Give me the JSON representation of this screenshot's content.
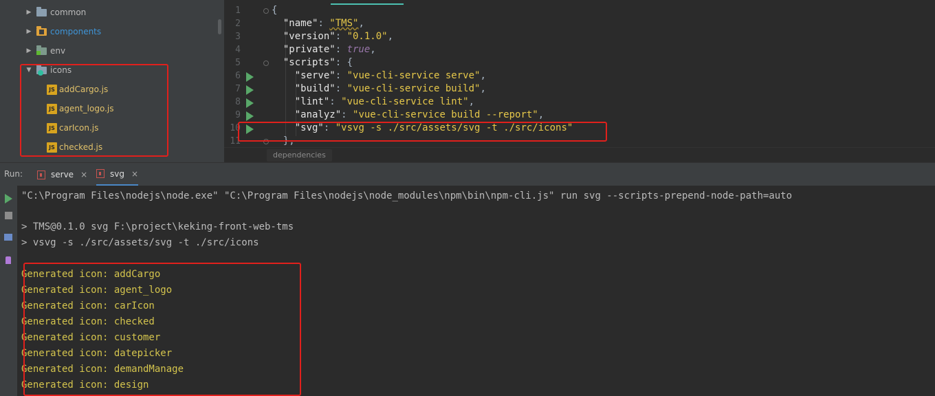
{
  "tree": {
    "items": [
      {
        "label": "common",
        "kind": "folder"
      },
      {
        "label": "components",
        "kind": "folder"
      },
      {
        "label": "env",
        "kind": "folder"
      },
      {
        "label": "icons",
        "kind": "folder"
      },
      {
        "label": "addCargo.js",
        "kind": "file"
      },
      {
        "label": "agent_logo.js",
        "kind": "file"
      },
      {
        "label": "carIcon.js",
        "kind": "file"
      },
      {
        "label": "checked.js",
        "kind": "file"
      }
    ],
    "js_badge": "JS"
  },
  "editor": {
    "line_numbers": [
      "1",
      "2",
      "3",
      "4",
      "5",
      "6",
      "7",
      "8",
      "9",
      "10",
      "11"
    ],
    "lines": {
      "l1": "{",
      "l2_key": "\"name\"",
      "l2_val": "\"TMS\"",
      "l3_key": "\"version\"",
      "l3_val": "\"0.1.0\"",
      "l4_key": "\"private\"",
      "l4_val": "true",
      "l5_key": "\"scripts\"",
      "l5_rest": ": {",
      "l6_key": "\"serve\"",
      "l6_val": "\"vue-cli-service serve\"",
      "l7_key": "\"build\"",
      "l7_val": "\"vue-cli-service build\"",
      "l8_key": "\"lint\"",
      "l8_val": "\"vue-cli-service lint\"",
      "l9_key": "\"analyz\"",
      "l9_val": "\"vue-cli-service build --report\"",
      "l10_key": "\"svg\"",
      "l10_val": "\"vsvg -s ./src/assets/svg -t ./src/icons\"",
      "l11": "},"
    },
    "breadcrumb": "dependencies"
  },
  "run": {
    "label": "Run:",
    "tabs": [
      {
        "label": "serve"
      },
      {
        "label": "svg"
      }
    ],
    "close_glyph": "×",
    "console": {
      "command": "\"C:\\Program Files\\nodejs\\node.exe\" \"C:\\Program Files\\nodejs\\node_modules\\npm\\bin\\npm-cli.js\" run svg --scripts-prepend-node-path=auto",
      "line2": "> TMS@0.1.0 svg F:\\project\\keking-front-web-tms",
      "line3": "> vsvg -s ./src/assets/svg -t ./src/icons",
      "generated": [
        "Generated icon: addCargo",
        "Generated icon: agent_logo",
        "Generated icon: carIcon",
        "Generated icon: checked",
        "Generated icon: customer",
        "Generated icon: datepicker",
        "Generated icon: demandManage",
        "Generated icon: design"
      ]
    }
  },
  "colors": {
    "highlight": "#e1201c",
    "accent": "#4dc1b2",
    "run_green": "#59a869"
  }
}
